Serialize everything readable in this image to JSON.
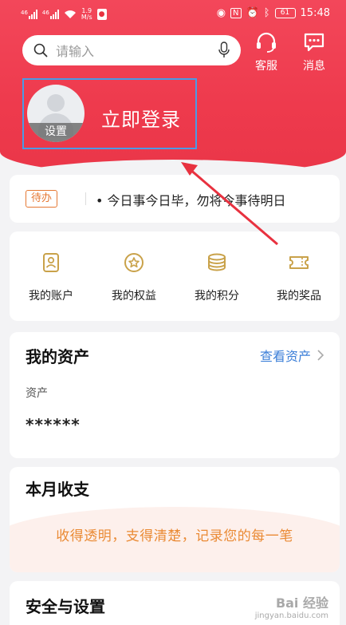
{
  "status_bar": {
    "network_left": "46",
    "network_right": "46",
    "speed": "1.9",
    "speed_unit": "M/s",
    "network_type": "N",
    "battery": "61",
    "time": "15:48"
  },
  "header": {
    "search": {
      "placeholder": "请输入",
      "icon": "search-icon",
      "voice_icon": "microphone-icon"
    },
    "service": {
      "label": "客服",
      "icon": "headset-icon"
    },
    "messages": {
      "label": "消息",
      "icon": "chat-icon"
    },
    "gradient_color": "#ee3a4d"
  },
  "profile": {
    "avatar_settings_label": "设置",
    "login_label": "立即登录"
  },
  "todo": {
    "badge": "待办",
    "text": "• 今日事今日毕，勿将今事待明日"
  },
  "shortcuts": [
    {
      "label": "我的账户",
      "icon": "account-icon"
    },
    {
      "label": "我的权益",
      "icon": "star-badge-icon"
    },
    {
      "label": "我的积分",
      "icon": "coins-icon"
    },
    {
      "label": "我的奖品",
      "icon": "ticket-icon"
    }
  ],
  "assets": {
    "title": "我的资产",
    "view_link": "查看资产",
    "label": "资产",
    "value": "******"
  },
  "monthly": {
    "title": "本月收支",
    "slogan": "收得透明，支得清楚，记录您的每一笔"
  },
  "security": {
    "title": "安全与设置"
  },
  "watermark": {
    "text": "Bai 经验",
    "sub": "jingyan.baidu.com"
  },
  "colors": {
    "accent_red": "#ee3a4d",
    "link_blue": "#3c7fd8",
    "highlight_blue": "#4a9be6",
    "gold": "#c9a24a",
    "slogan_orange": "#ea8a34"
  }
}
